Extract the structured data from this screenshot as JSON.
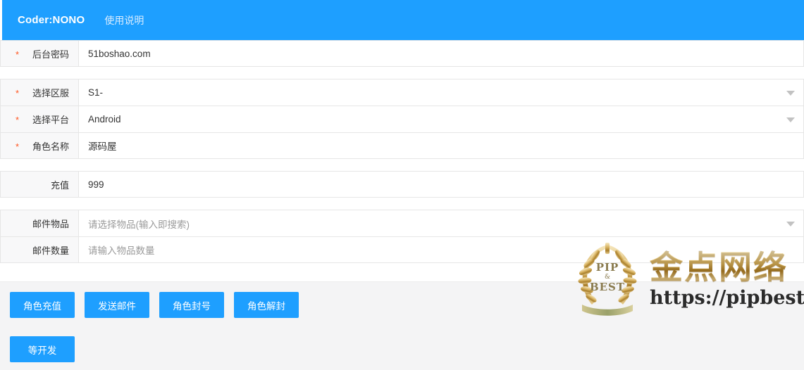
{
  "header": {
    "title": "Coder:NONO",
    "link_label": "使用说明"
  },
  "form": {
    "groups": [
      {
        "rows": [
          {
            "label": "后台密码",
            "required": true,
            "value": "51boshao.com",
            "is_placeholder": false,
            "has_chevron": false
          }
        ]
      },
      {
        "rows": [
          {
            "label": "选择区服",
            "required": true,
            "value": "S1-",
            "is_placeholder": false,
            "has_chevron": true
          },
          {
            "label": "选择平台",
            "required": true,
            "value": "Android",
            "is_placeholder": false,
            "has_chevron": true
          },
          {
            "label": "角色名称",
            "required": true,
            "value": "源码屋",
            "is_placeholder": false,
            "has_chevron": false
          }
        ]
      },
      {
        "rows": [
          {
            "label": "充值",
            "required": false,
            "value": "999",
            "is_placeholder": false,
            "has_chevron": false
          }
        ]
      },
      {
        "rows": [
          {
            "label": "邮件物品",
            "required": false,
            "value": "请选择物品(输入即搜索)",
            "is_placeholder": true,
            "has_chevron": true
          },
          {
            "label": "邮件数量",
            "required": false,
            "value": "请输入物品数量",
            "is_placeholder": true,
            "has_chevron": false
          }
        ]
      }
    ]
  },
  "actions": {
    "row1": [
      {
        "label": "角色充值",
        "name": "recharge-role-button"
      },
      {
        "label": "发送邮件",
        "name": "send-mail-button"
      },
      {
        "label": "角色封号",
        "name": "ban-role-button"
      },
      {
        "label": "角色解封",
        "name": "unban-role-button"
      }
    ],
    "row2": [
      {
        "label": "等开发",
        "name": "pending-dev-button"
      }
    ]
  },
  "watermark": {
    "brand_cn": "金点网络",
    "url": "https://pipbest.com",
    "emblem_top": "PIP",
    "emblem_amp": "&",
    "emblem_bottom": "BEST",
    "registered_mark": "®"
  },
  "colors": {
    "accent": "#1E9FFF",
    "required_star": "#ff5722",
    "label_bg": "#f8f8f9",
    "panel_bg": "#f4f4f5",
    "text": "#333333",
    "placeholder": "#9a9a9a"
  }
}
